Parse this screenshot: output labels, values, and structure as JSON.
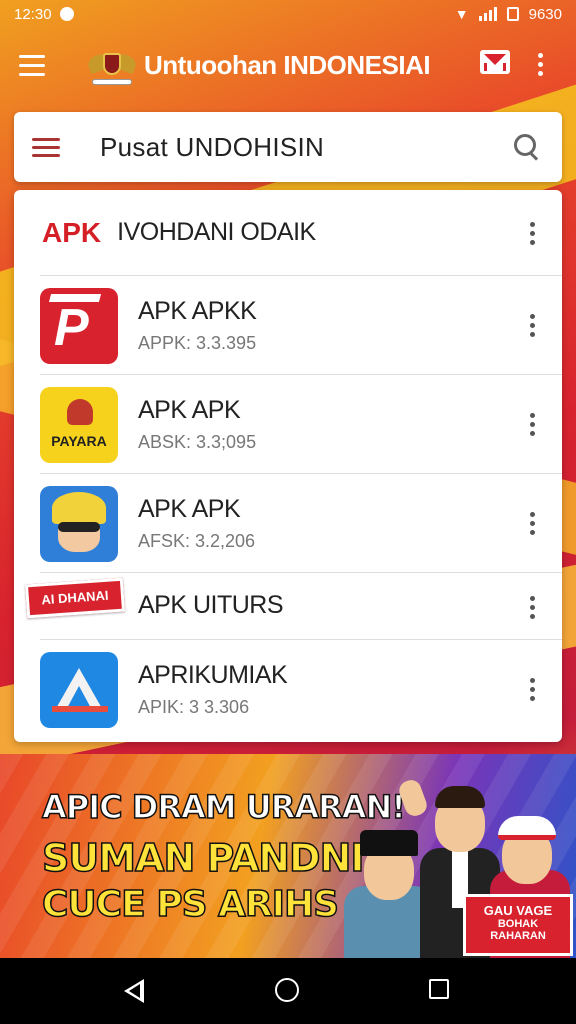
{
  "status_bar": {
    "time": "12:30",
    "battery_text": "9630"
  },
  "app_bar": {
    "title": "Untuoohan INDONESIAI"
  },
  "search": {
    "text": "Pusat UNDOHISIN"
  },
  "list": {
    "header_tag": "APK",
    "header_title": "IVOHDANI ODAIK",
    "items": [
      {
        "title": "APK APKK",
        "subtitle": "APPK: 3.3.395",
        "icon": "red-p-icon"
      },
      {
        "title": "APK APK",
        "subtitle": "ABSK: 3.3;095",
        "icon": "garuda-yellow-icon",
        "icon_label": "PAYARA"
      },
      {
        "title": "APK APK",
        "subtitle": "AFSK: 3.2,206",
        "icon": "helmet-character-icon"
      },
      {
        "title": "APK UITURS",
        "subtitle": "",
        "icon": "banner-icon",
        "icon_label": "AI DHANAI"
      },
      {
        "title": "APRIKUMIAK",
        "subtitle": "APIK: 3 3.306",
        "icon": "triangle-logo-icon"
      }
    ]
  },
  "promo": {
    "line1": "APIC DRAM URARAN!",
    "line2": "SUMAN PANDNI!",
    "line3": "CUCE PS ARIHS",
    "sign_line1": "GAU VAGE",
    "sign_line2": "BOHAK",
    "sign_line3": "RAHARAN"
  },
  "colors": {
    "brand_red": "#d8232e",
    "accent_yellow": "#f4c21d"
  }
}
